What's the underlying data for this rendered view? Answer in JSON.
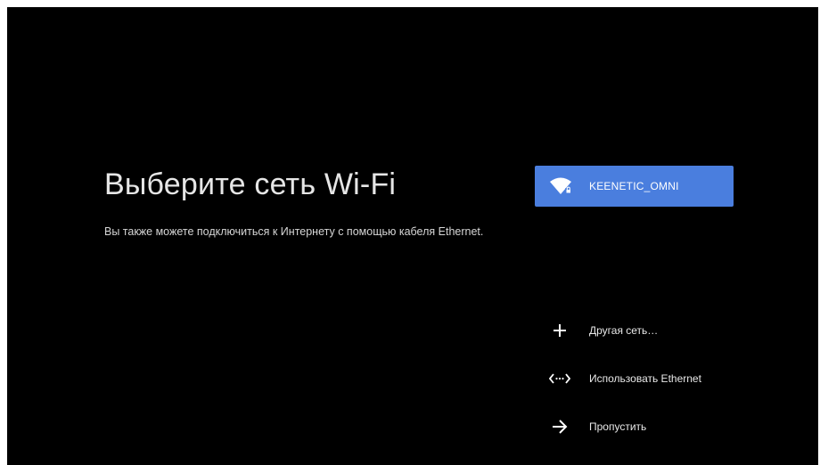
{
  "setup": {
    "title": "Выберите сеть Wi-Fi",
    "subtitle": "Вы также можете подключиться к Интернету с помощью кабеля Ethernet."
  },
  "networks": [
    {
      "ssid": "KEENETIC_OMNI",
      "icon": "wifi-locked-icon",
      "selected": true
    }
  ],
  "options": [
    {
      "label": "Другая сеть…",
      "icon": "plus-icon"
    },
    {
      "label": "Использовать Ethernet",
      "icon": "ethernet-icon"
    },
    {
      "label": "Пропустить",
      "icon": "arrow-right-icon"
    }
  ],
  "colors": {
    "background": "#000000",
    "selected_network": "#4a7ede",
    "text": "#ffffff"
  }
}
